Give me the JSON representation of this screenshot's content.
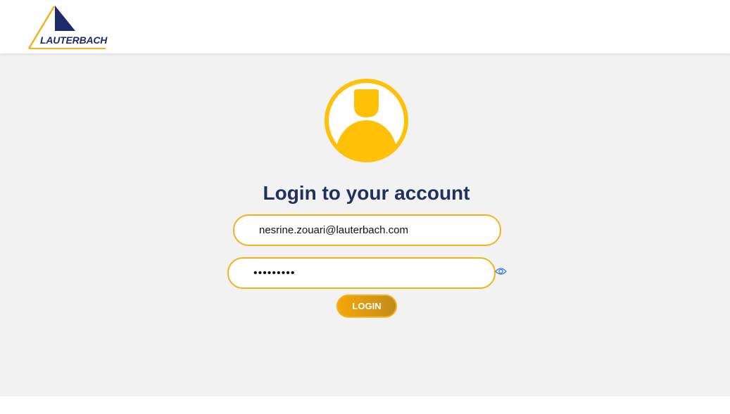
{
  "header": {
    "logo_text": "LAUTERBACH"
  },
  "login": {
    "title": "Login to your account",
    "email_value": "nesrine.zouari@lauterbach.com",
    "password_value": "•••••••••",
    "button_label": "LOGIN"
  },
  "icons": {
    "avatar": "user-avatar-icon",
    "eye": "eye-icon",
    "logo": "lauterbach-logo"
  },
  "colors": {
    "accent": "#f2b21c",
    "avatar": "#ffc107",
    "title": "#22305e",
    "logo_blue": "#1e2b6b",
    "eye": "#3d7be0",
    "background": "#f2f2f2"
  }
}
